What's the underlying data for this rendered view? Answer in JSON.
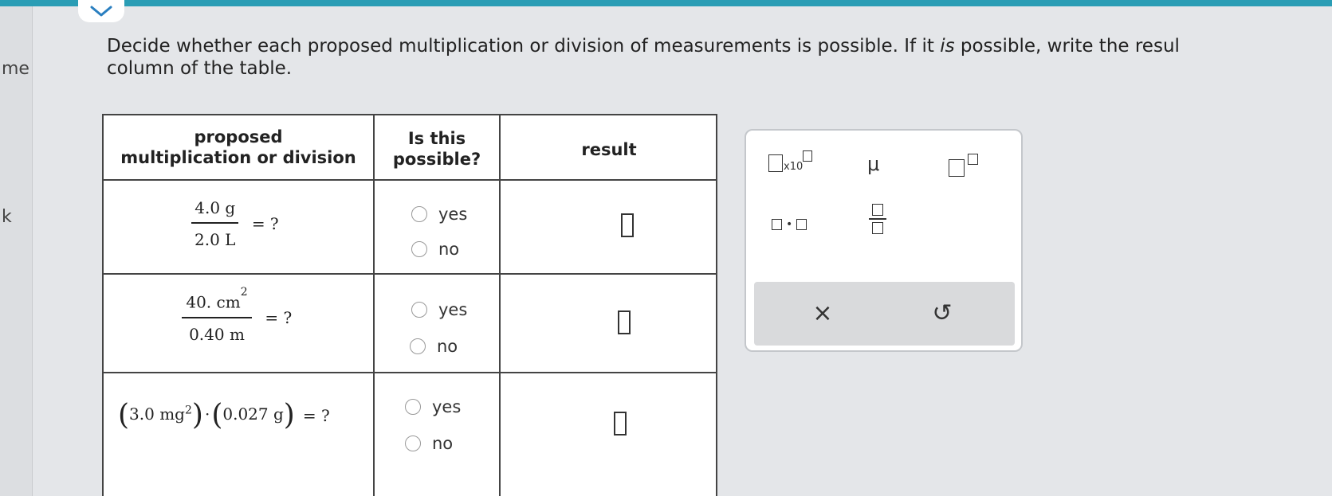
{
  "left_strip": {
    "label_top": "me",
    "label_mid": "k"
  },
  "instruction": {
    "part1": "Decide whether each proposed multiplication or division of measurements is possible. If it ",
    "part_italic": "is",
    "part2": " possible, write the resul",
    "line2": "column of the table."
  },
  "table": {
    "headers": {
      "col1_line1": "proposed",
      "col1_line2": "multiplication or division",
      "col2_line1": "Is this",
      "col2_line2": "possible?",
      "col3": "result"
    },
    "rows": [
      {
        "num": "4.0 g",
        "den": "2.0 L",
        "eq": "= ?",
        "yes": "yes",
        "no": "no"
      },
      {
        "num": "40. cm",
        "num_exp": "2",
        "den": "0.40 m",
        "eq": "= ?",
        "yes": "yes",
        "no": "no"
      },
      {
        "f1": "3.0 mg",
        "f1_exp": "2",
        "dot": "·",
        "f2": "0.027 g",
        "eq": "= ?",
        "yes": "yes",
        "no": "no"
      }
    ]
  },
  "palette": {
    "x10_label": "x10",
    "mu_label": "μ",
    "dot_label": "•",
    "clear_symbol": "×",
    "undo_symbol": "↺"
  }
}
